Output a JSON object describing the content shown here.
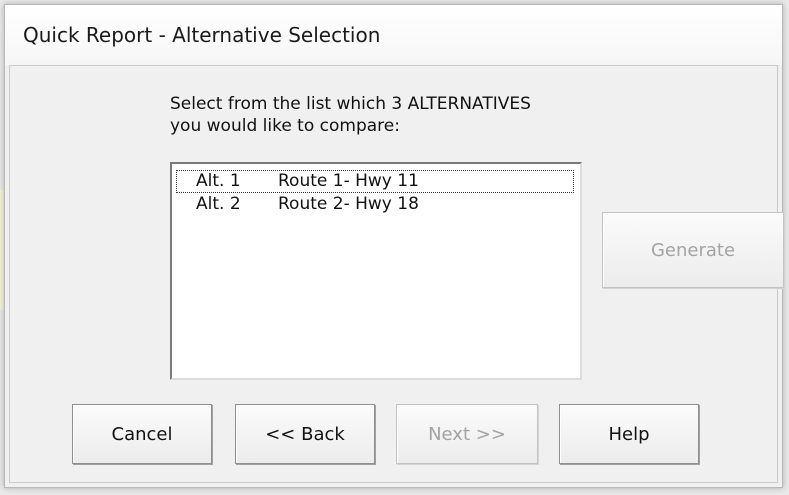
{
  "dialog": {
    "title": "Quick Report - Alternative Selection",
    "instructions_line1": "Select from the list which 3 ALTERNATIVES",
    "instructions_line2": "you would like to compare:",
    "list_items": [
      {
        "alt": "Alt. 1",
        "description": "Route 1- Hwy 11"
      },
      {
        "alt": "Alt. 2",
        "description": "Route 2- Hwy 18"
      }
    ],
    "buttons": {
      "generate": "Generate",
      "cancel": "Cancel",
      "back": "<< Back",
      "next": "Next >>",
      "help": "Help"
    }
  },
  "colors": {
    "dialog_background": "#f0f0f0",
    "disabled_text": "#a3a3a3"
  }
}
